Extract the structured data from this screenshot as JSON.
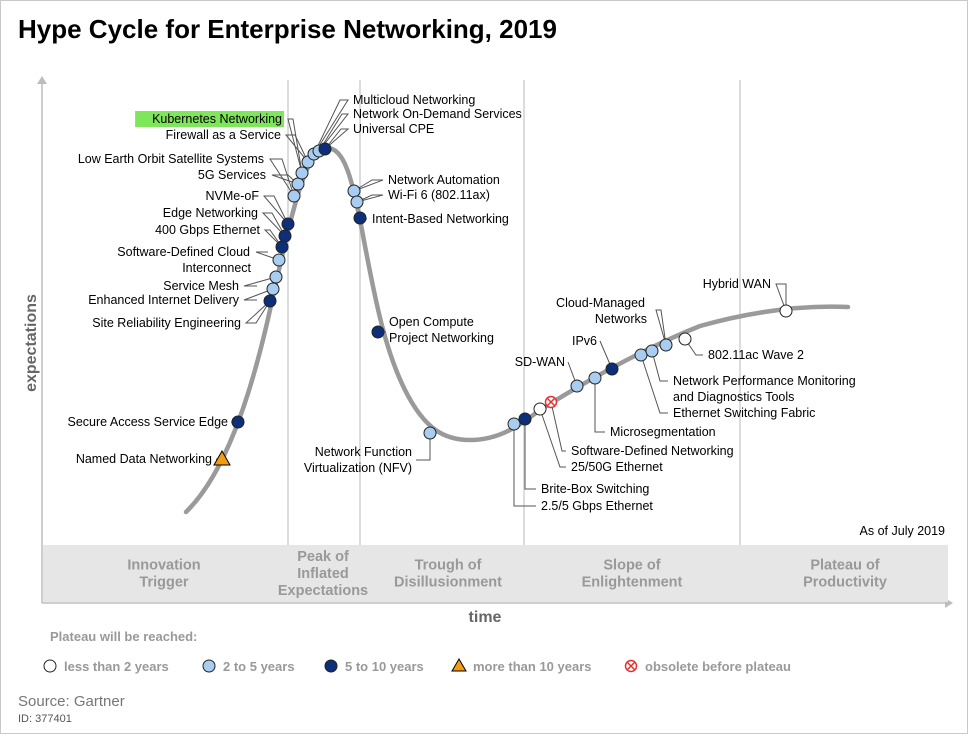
{
  "title": "Hype Cycle for Enterprise Networking, 2019",
  "source": "Source: Gartner",
  "id_label": "ID: 377401",
  "colors": {
    "curve": "#9a9a9a",
    "less_than_2": "#ffffff",
    "two_to_5": "#a9cdf0",
    "five_to_10": "#0d2f7a",
    "more_than_10": "#f39c12",
    "obsolete": "#e63030",
    "highlight": "#7fe65c",
    "phase_band": "#e6e6e6",
    "phase_text": "#999999"
  },
  "chart_data": {
    "type": "scatter",
    "title": "Hype Cycle for Enterprise Networking, 2019",
    "xlabel": "time",
    "ylabel": "expectations",
    "as_of": "As of July 2019",
    "phases": [
      {
        "name": "Innovation Trigger",
        "label": "Innovation\nTrigger"
      },
      {
        "name": "Peak of Inflated Expectations",
        "label": "Peak of\nInflated\nExpectations"
      },
      {
        "name": "Trough of Disillusionment",
        "label": "Trough of\nDisillusionment"
      },
      {
        "name": "Slope of Enlightenment",
        "label": "Slope of\nEnlightenment"
      },
      {
        "name": "Plateau of Productivity",
        "label": "Plateau of\nProductivity"
      }
    ],
    "legend": {
      "title": "Plateau will be reached:",
      "items": [
        {
          "key": "lt2",
          "label": "less than 2 years"
        },
        {
          "key": "2to5",
          "label": "2 to 5 years"
        },
        {
          "key": "5to10",
          "label": "5 to 10 years"
        },
        {
          "key": "gt10",
          "label": "more than 10 years"
        },
        {
          "key": "obs",
          "label": "obsolete before plateau"
        }
      ]
    },
    "technologies": [
      {
        "name": "Named Data Networking",
        "phase": "Innovation Trigger",
        "plateau": "gt10"
      },
      {
        "name": "Secure Access Service Edge",
        "phase": "Innovation Trigger",
        "plateau": "5to10"
      },
      {
        "name": "Site Reliability Engineering",
        "phase": "Innovation Trigger",
        "plateau": "5to10"
      },
      {
        "name": "Enhanced Internet Delivery",
        "phase": "Innovation Trigger",
        "plateau": "2to5"
      },
      {
        "name": "Service Mesh",
        "phase": "Innovation Trigger",
        "plateau": "2to5"
      },
      {
        "name": "Software-Defined Cloud Interconnect",
        "phase": "Innovation Trigger",
        "plateau": "2to5"
      },
      {
        "name": "400 Gbps Ethernet",
        "phase": "Innovation Trigger",
        "plateau": "5to10"
      },
      {
        "name": "Edge Networking",
        "phase": "Innovation Trigger",
        "plateau": "5to10"
      },
      {
        "name": "NVMe-oF",
        "phase": "Innovation Trigger",
        "plateau": "5to10"
      },
      {
        "name": "5G Services",
        "phase": "Innovation Trigger",
        "plateau": "2to5"
      },
      {
        "name": "Low Earth Orbit Satellite Systems",
        "phase": "Innovation Trigger",
        "plateau": "2to5"
      },
      {
        "name": "Kubernetes Networking",
        "phase": "Peak of Inflated Expectations",
        "plateau": "2to5",
        "highlight": true
      },
      {
        "name": "Firewall as a Service",
        "phase": "Peak of Inflated Expectations",
        "plateau": "2to5"
      },
      {
        "name": "Multicloud Networking",
        "phase": "Peak of Inflated Expectations",
        "plateau": "2to5"
      },
      {
        "name": "Network On-Demand Services",
        "phase": "Peak of Inflated Expectations",
        "plateau": "2to5"
      },
      {
        "name": "Universal CPE",
        "phase": "Peak of Inflated Expectations",
        "plateau": "5to10"
      },
      {
        "name": "Network Automation",
        "phase": "Trough of Disillusionment",
        "plateau": "2to5"
      },
      {
        "name": "Wi-Fi 6 (802.11ax)",
        "phase": "Trough of Disillusionment",
        "plateau": "2to5"
      },
      {
        "name": "Intent-Based Networking",
        "phase": "Trough of Disillusionment",
        "plateau": "5to10"
      },
      {
        "name": "Open Compute Project Networking",
        "phase": "Trough of Disillusionment",
        "plateau": "5to10"
      },
      {
        "name": "Network Function Virtualization (NFV)",
        "phase": "Trough of Disillusionment",
        "plateau": "2to5"
      },
      {
        "name": "2.5/5 Gbps Ethernet",
        "phase": "Slope of Enlightenment",
        "plateau": "2to5"
      },
      {
        "name": "Brite-Box Switching",
        "phase": "Slope of Enlightenment",
        "plateau": "5to10"
      },
      {
        "name": "25/50G Ethernet",
        "phase": "Slope of Enlightenment",
        "plateau": "lt2"
      },
      {
        "name": "Software-Defined Networking",
        "phase": "Slope of Enlightenment",
        "plateau": "obs"
      },
      {
        "name": "SD-WAN",
        "phase": "Slope of Enlightenment",
        "plateau": "2to5"
      },
      {
        "name": "Microsegmentation",
        "phase": "Slope of Enlightenment",
        "plateau": "2to5"
      },
      {
        "name": "IPv6",
        "phase": "Slope of Enlightenment",
        "plateau": "5to10"
      },
      {
        "name": "Ethernet Switching Fabric",
        "phase": "Slope of Enlightenment",
        "plateau": "2to5"
      },
      {
        "name": "Network Performance Monitoring and Diagnostics Tools",
        "phase": "Slope of Enlightenment",
        "plateau": "2to5"
      },
      {
        "name": "Cloud-Managed Networks",
        "phase": "Slope of Enlightenment",
        "plateau": "2to5"
      },
      {
        "name": "802.11ac Wave 2",
        "phase": "Slope of Enlightenment",
        "plateau": "lt2"
      },
      {
        "name": "Hybrid WAN",
        "phase": "Plateau of Productivity",
        "plateau": "lt2"
      }
    ]
  }
}
